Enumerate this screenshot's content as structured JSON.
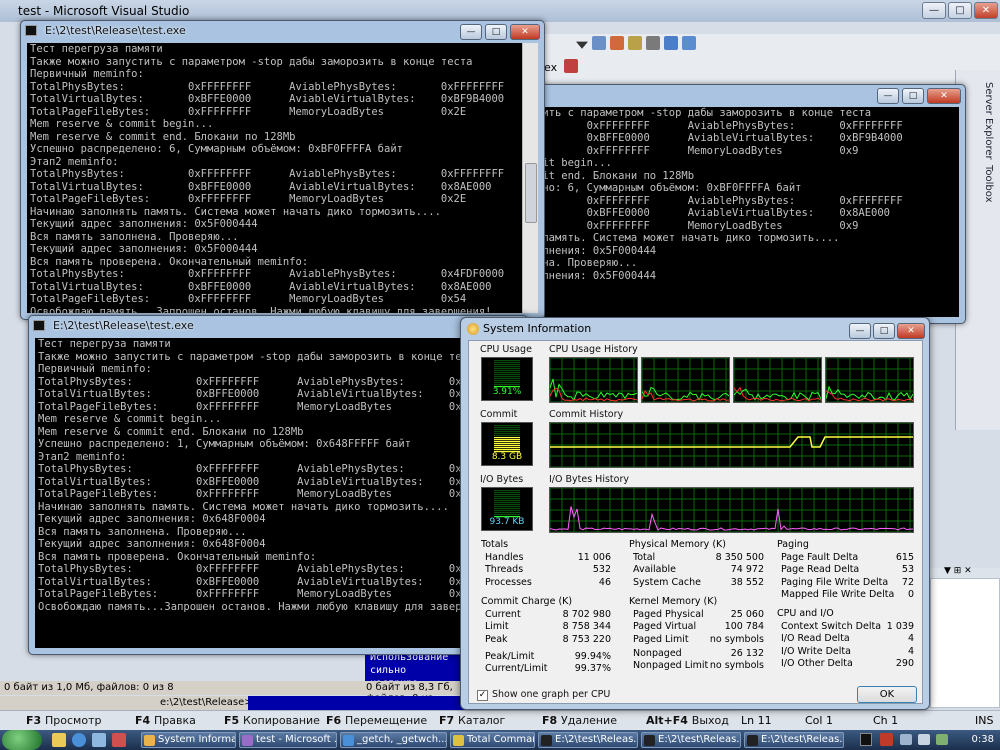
{
  "vs": {
    "title": "test - Microsoft Visual Studio",
    "side_tabs": [
      "Server Explorer",
      "Toolbox"
    ],
    "status": {
      "ln": "Ln 11",
      "col": "Col 1",
      "ch": "Ch 1",
      "ins": "INS"
    }
  },
  "console_back": {
    "title": "E:\\2\\test\\Release\\test.exe",
    "lines": [
      "Тест перегруза памяти",
      "Также можно запустить с параметром -stop дабы заморозить в конце теста",
      "Первичный meminfo:",
      "TotalPhysBytes:          0xFFFFFFFF      AviablePhysBytes:       0xFFFFFFFF",
      "TotalVirtualBytes:       0xBFFE0000      AviableVirtualBytes:    0xBF9B4000",
      "TotalPageFileBytes:      0xFFFFFFFF      MemoryLoadBytes         0x2E",
      "Mem reserve & commit begin...",
      "Mem reserve & commit end. Блокани по 128Mb",
      "Успешно распределено: 6, Суммарным объёмом: 0xBF0FFFFA байт",
      "Этап2 meminfo:",
      "TotalPhysBytes:          0xFFFFFFFF      AviablePhysBytes:       0xFFFFFFFF",
      "TotalVirtualBytes:       0xBFFE0000      AviableVirtualBytes:    0x8AE000",
      "TotalPageFileBytes:      0xFFFFFFFF      MemoryLoadBytes         0x2E",
      "Начинаю заполнять память. Система может начать дико тормозить....",
      "Текущий адрес заполнения: 0x5F000444",
      "Вся память заполнена. Проверяю...",
      "Текущий адрес заполнения: 0x5F000444",
      "Вся память проверена. Окончательный meminfo:",
      "TotalPhysBytes:          0xFFFFFFFF      AviablePhysBytes:       0x4FDF0000",
      "TotalVirtualBytes:       0xBFFE0000      AviableVirtualBytes:    0x8AE000",
      "TotalPageFileBytes:      0xFFFFFFFF      MemoryLoadBytes         0x54",
      "Освобождаю память...Запрошен останов. Нажми любую клавишу для завершения!"
    ]
  },
  "console_right": {
    "lines": [
      "",
      "тить с параметром -stop дабы заморозить в конце теста",
      "",
      "        0xFFFFFFFF      AviablePhysBytes:       0xFFFFFFFF",
      "        0xBFFE0000      AviableVirtualBytes:    0xBF9B4000",
      "        0xFFFFFFFF      MemoryLoadBytes         0x9",
      "mit begin...",
      "mit end. Блокани по 128Mb",
      "ено: 6, Суммарным объёмом: 0xBF0FFFFA байт",
      "",
      "        0xFFFFFFFF      AviablePhysBytes:       0xFFFFFFFF",
      "        0xBFFE0000      AviableVirtualBytes:    0x8AE000",
      "        0xFFFFFFFF      MemoryLoadBytes         0x9",
      " память. Система может начать дико тормозить....",
      "олнения: 0x5F000444",
      "ена. Проверяю...",
      "олнения: 0x5F000444"
    ]
  },
  "console_front": {
    "title": "E:\\2\\test\\Release\\test.exe",
    "lines": [
      "Тест перегруза памяти",
      "Также можно запустить с параметром -stop дабы заморозить в конце теста",
      "Первичный meminfo:",
      "TotalPhysBytes:          0xFFFFFFFF      AviablePhysBytes:       0x4F",
      "TotalVirtualBytes:       0xBFFE0000      AviableVirtualBytes:    0xBF",
      "TotalPageFileBytes:      0xFFFFFFFF      MemoryLoadBytes         0x54",
      "Mem reserve & commit begin...",
      "Mem reserve & commit end. Блокани по 128Mb",
      "Успешно распределено: 1, Суммарным объёмом: 0x648FFFFF байт",
      "Этап2 meminfo:",
      "TotalPhysBytes:          0xFFFFFFFF      AviablePhysBytes:       0x4F",
      "TotalVirtualBytes:       0xBFFE0000      AviableVirtualBytes:    0x5B",
      "TotalPageFileBytes:      0xFFFFFFFF      MemoryLoadBytes         0x54",
      "Начинаю заполнять память. Система может начать дико тормозить....",
      "Текущий адрес заполнения: 0x648F0004",
      "Вся память заполнена. Проверяю...",
      "Текущий адрес заполнения: 0x648F0004",
      "Вся память проверена. Окончательный meminfo:",
      "TotalPhysBytes:          0xFFFFFFFF      AviablePhysBytes:       0x2E",
      "TotalVirtualBytes:       0xBFFE0000      AviableVirtualBytes:    0x5B",
      "TotalPageFileBytes:      0xFFFFFFFF      MemoryLoadBytes         0x63",
      "Освобождаю память...Запрошен останов. Нажми любую клавишу для заверш"
    ]
  },
  "far": {
    "blue_lines": [
      "Использование",
      "сильно кастриро"
    ],
    "info_left": "0 байт из 1,0 Мб, файлов: 0 из 8",
    "info_right": "0 байт из 8,3 Гб, файлов: 0 из",
    "cmd_prompt": "e:\\2\\test\\Release>",
    "fkeys": [
      {
        "key": "F3",
        "label": "Просмотр"
      },
      {
        "key": "F4",
        "label": "Правка"
      },
      {
        "key": "F5",
        "label": "Копирование"
      },
      {
        "key": "F6",
        "label": "Перемещение"
      },
      {
        "key": "F7",
        "label": "Каталог"
      },
      {
        "key": "F8",
        "label": "Удаление"
      },
      {
        "key": "Alt+F4",
        "label": "Выход"
      }
    ]
  },
  "sysinfo": {
    "title": "System Information",
    "labels": {
      "cpu_usage": "CPU Usage",
      "cpu_history": "CPU Usage History",
      "commit": "Commit",
      "commit_history": "Commit History",
      "io_bytes": "I/O Bytes",
      "io_history": "I/O Bytes History"
    },
    "cpu_value": "3.91%",
    "cpu_level": 0.04,
    "commit_value": "8.3 GB",
    "commit_level": 0.55,
    "io_value": "93.7 KB",
    "io_level": 0.05,
    "totals": {
      "title": "Totals",
      "rows": [
        [
          "Handles",
          "11 006"
        ],
        [
          "Threads",
          "532"
        ],
        [
          "Processes",
          "46"
        ]
      ]
    },
    "commit_charge": {
      "title": "Commit Charge (K)",
      "rows": [
        [
          "Current",
          "8 702 980"
        ],
        [
          "Limit",
          "8 758 344"
        ],
        [
          "Peak",
          "8 753 220"
        ]
      ]
    },
    "peak_limit": {
      "rows": [
        [
          "Peak/Limit",
          "99.94%"
        ],
        [
          "Current/Limit",
          "99.37%"
        ]
      ]
    },
    "physical": {
      "title": "Physical Memory (K)",
      "rows": [
        [
          "Total",
          "8 350 500"
        ],
        [
          "Available",
          "74 972"
        ],
        [
          "System Cache",
          "38 552"
        ]
      ]
    },
    "kernel": {
      "title": "Kernel Memory (K)",
      "rows": [
        [
          "Paged Physical",
          "25 060"
        ],
        [
          "Paged Virtual",
          "100 784"
        ],
        [
          "Paged Limit",
          "no symbols"
        ],
        [
          "Nonpaged",
          "26 132"
        ],
        [
          "Nonpaged Limit",
          "no symbols"
        ]
      ]
    },
    "paging": {
      "title": "Paging",
      "rows": [
        [
          "Page Fault Delta",
          "615"
        ],
        [
          "Page Read Delta",
          "53"
        ],
        [
          "Paging File Write Delta",
          "72"
        ],
        [
          "Mapped File Write Delta",
          "0"
        ]
      ]
    },
    "cpuio": {
      "title": "CPU and I/O",
      "rows": [
        [
          "Context Switch Delta",
          "1 039"
        ],
        [
          "I/O Read Delta",
          "4"
        ],
        [
          "I/O Write Delta",
          "4"
        ],
        [
          "I/O Other Delta",
          "290"
        ]
      ]
    },
    "checkbox_label": "Show one graph per CPU",
    "ok_label": "OK"
  },
  "taskbar": {
    "items": [
      "System Informa...",
      "test - Microsoft ...",
      "_getch, _getwch...",
      "Total Comman...",
      "E:\\2\\test\\Releas...",
      "E:\\2\\test\\Releas...",
      "E:\\2\\test\\Releas..."
    ],
    "clock": "0:38"
  }
}
